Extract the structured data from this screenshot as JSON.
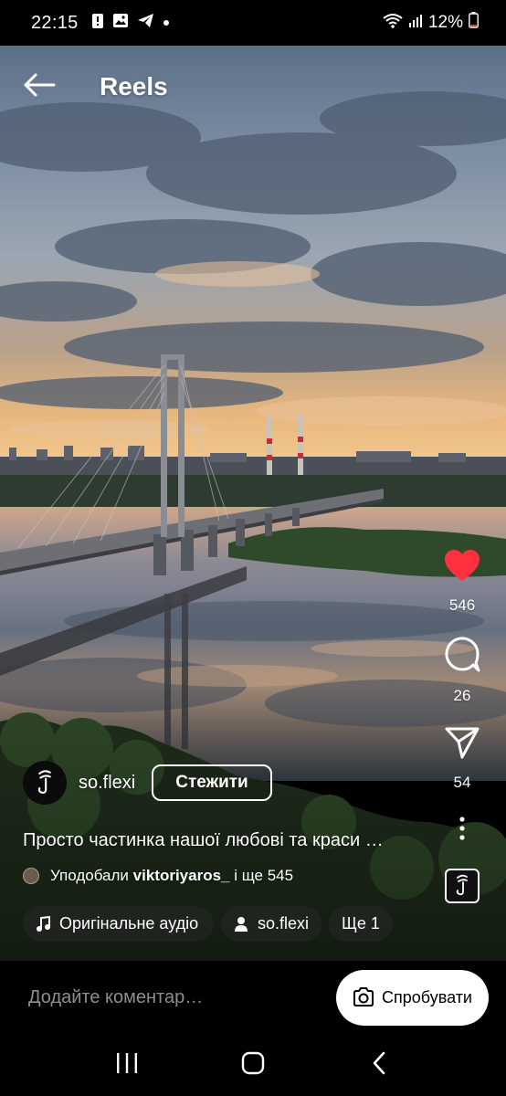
{
  "status_bar": {
    "time": "22:15",
    "notification_icons": [
      "alert-icon",
      "image-icon",
      "telegram-icon",
      "dot-icon"
    ],
    "battery": "12%",
    "right_icons": [
      "wifi-icon",
      "signal-icon",
      "battery-icon"
    ]
  },
  "header": {
    "title": "Reels",
    "back_icon": "back-arrow-icon"
  },
  "actions": {
    "like_count": "546",
    "comment_count": "26",
    "share_count": "54",
    "like_color": "#ff3040"
  },
  "author": {
    "username": "so.flexi",
    "follow_label": "Стежити"
  },
  "caption": {
    "text": "Просто частинка нашої любові та краси …"
  },
  "likes_line": {
    "prefix": "Уподобали",
    "user": "viktoriyaros_",
    "suffix": "і ще 545"
  },
  "chips": {
    "audio": "Оригінальне аудіо",
    "tagged_user": "so.flexi",
    "more": "Ще 1"
  },
  "comment_bar": {
    "placeholder": "Додайте коментар…",
    "try_label": "Спробувати"
  },
  "nav": {
    "icons": [
      "recents-icon",
      "home-icon",
      "back-icon"
    ]
  }
}
